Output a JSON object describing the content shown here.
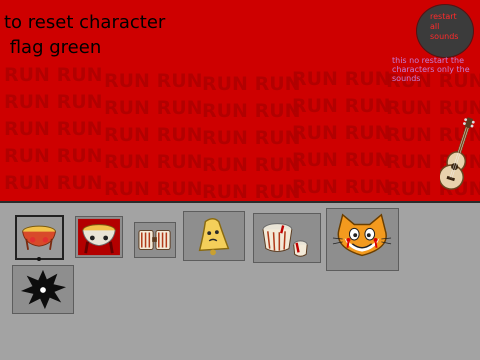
{
  "stage": {
    "title_line1": "to reset character",
    "title_line2": " flag green",
    "bg_color": "#ce0000",
    "run_word": "RUN RUN",
    "reset_button_label": "restart all sounds",
    "note": "this no restart the characters only the sounds"
  },
  "palette": {
    "sprites": [
      {
        "name": "drum-sprite",
        "selected": true
      },
      {
        "name": "bleeding-drum-sprite",
        "selected": false
      },
      {
        "name": "bongos-sprite",
        "selected": false
      },
      {
        "name": "bell-sprite",
        "selected": false
      },
      {
        "name": "bleeding-tabla-sprite",
        "selected": false
      },
      {
        "name": "scratch-cat-sprite",
        "selected": false
      },
      {
        "name": "black-splat-sprite",
        "selected": false
      }
    ]
  }
}
